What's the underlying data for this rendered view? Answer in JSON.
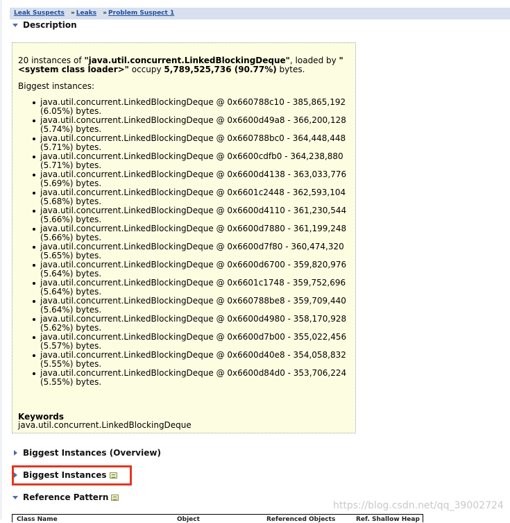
{
  "breadcrumb": {
    "items": [
      "Leak Suspects",
      "Leaks",
      "Problem Suspect 1"
    ],
    "separator": "»"
  },
  "description": {
    "heading": "Description",
    "intro_prefix": "20 instances of ",
    "class_name": "\"java.util.concurrent.LinkedBlockingDeque\"",
    "loaded_by_text": ", loaded by ",
    "loader_name": "\"<system class loader>\"",
    "occupy_text": " occupy ",
    "total_size": "5,789,525,736 (90.77%)",
    "bytes_suffix": " bytes.",
    "biggest_label": "Biggest instances:",
    "instances": [
      "java.util.concurrent.LinkedBlockingDeque @ 0x660788c10 - 385,865,192 (6.05%) bytes.",
      "java.util.concurrent.LinkedBlockingDeque @ 0x6600d49a8 - 366,200,128 (5.74%) bytes.",
      "java.util.concurrent.LinkedBlockingDeque @ 0x660788bc0 - 364,448,448 (5.71%) bytes.",
      "java.util.concurrent.LinkedBlockingDeque @ 0x6600cdfb0 - 364,238,880 (5.71%) bytes.",
      "java.util.concurrent.LinkedBlockingDeque @ 0x6600d4138 - 363,033,776 (5.69%) bytes.",
      "java.util.concurrent.LinkedBlockingDeque @ 0x6601c2448 - 362,593,104 (5.68%) bytes.",
      "java.util.concurrent.LinkedBlockingDeque @ 0x6600d4110 - 361,230,544 (5.66%) bytes.",
      "java.util.concurrent.LinkedBlockingDeque @ 0x6600d7880 - 361,199,248 (5.66%) bytes.",
      "java.util.concurrent.LinkedBlockingDeque @ 0x6600d7f80 - 360,474,320 (5.65%) bytes.",
      "java.util.concurrent.LinkedBlockingDeque @ 0x6600d6700 - 359,820,976 (5.64%) bytes.",
      "java.util.concurrent.LinkedBlockingDeque @ 0x6601c1748 - 359,752,696 (5.64%) bytes.",
      "java.util.concurrent.LinkedBlockingDeque @ 0x660788be8 - 359,709,440 (5.64%) bytes.",
      "java.util.concurrent.LinkedBlockingDeque @ 0x6600d4980 - 358,170,928 (5.62%) bytes.",
      "java.util.concurrent.LinkedBlockingDeque @ 0x6600d7b00 - 355,022,456 (5.57%) bytes.",
      "java.util.concurrent.LinkedBlockingDeque @ 0x6600d40e8 - 354,058,832 (5.55%) bytes.",
      "java.util.concurrent.LinkedBlockingDeque @ 0x6600d84d0 - 353,706,224 (5.55%) bytes."
    ],
    "keywords_title": "Keywords",
    "keywords_value": "java.util.concurrent.LinkedBlockingDeque"
  },
  "sections": {
    "overview": "Biggest Instances (Overview)",
    "biggest": "Biggest Instances",
    "reference": "Reference Pattern"
  },
  "ref_table_headers": [
    "Class Name",
    "Object",
    "Referenced Objects",
    "Ref. Shallow Heap"
  ],
  "watermark": "https://blog.csdn.net/qq_39002724",
  "colors": {
    "highlight": "#e2361f",
    "panel": "#fdfde2",
    "link": "#1f4ea1"
  }
}
